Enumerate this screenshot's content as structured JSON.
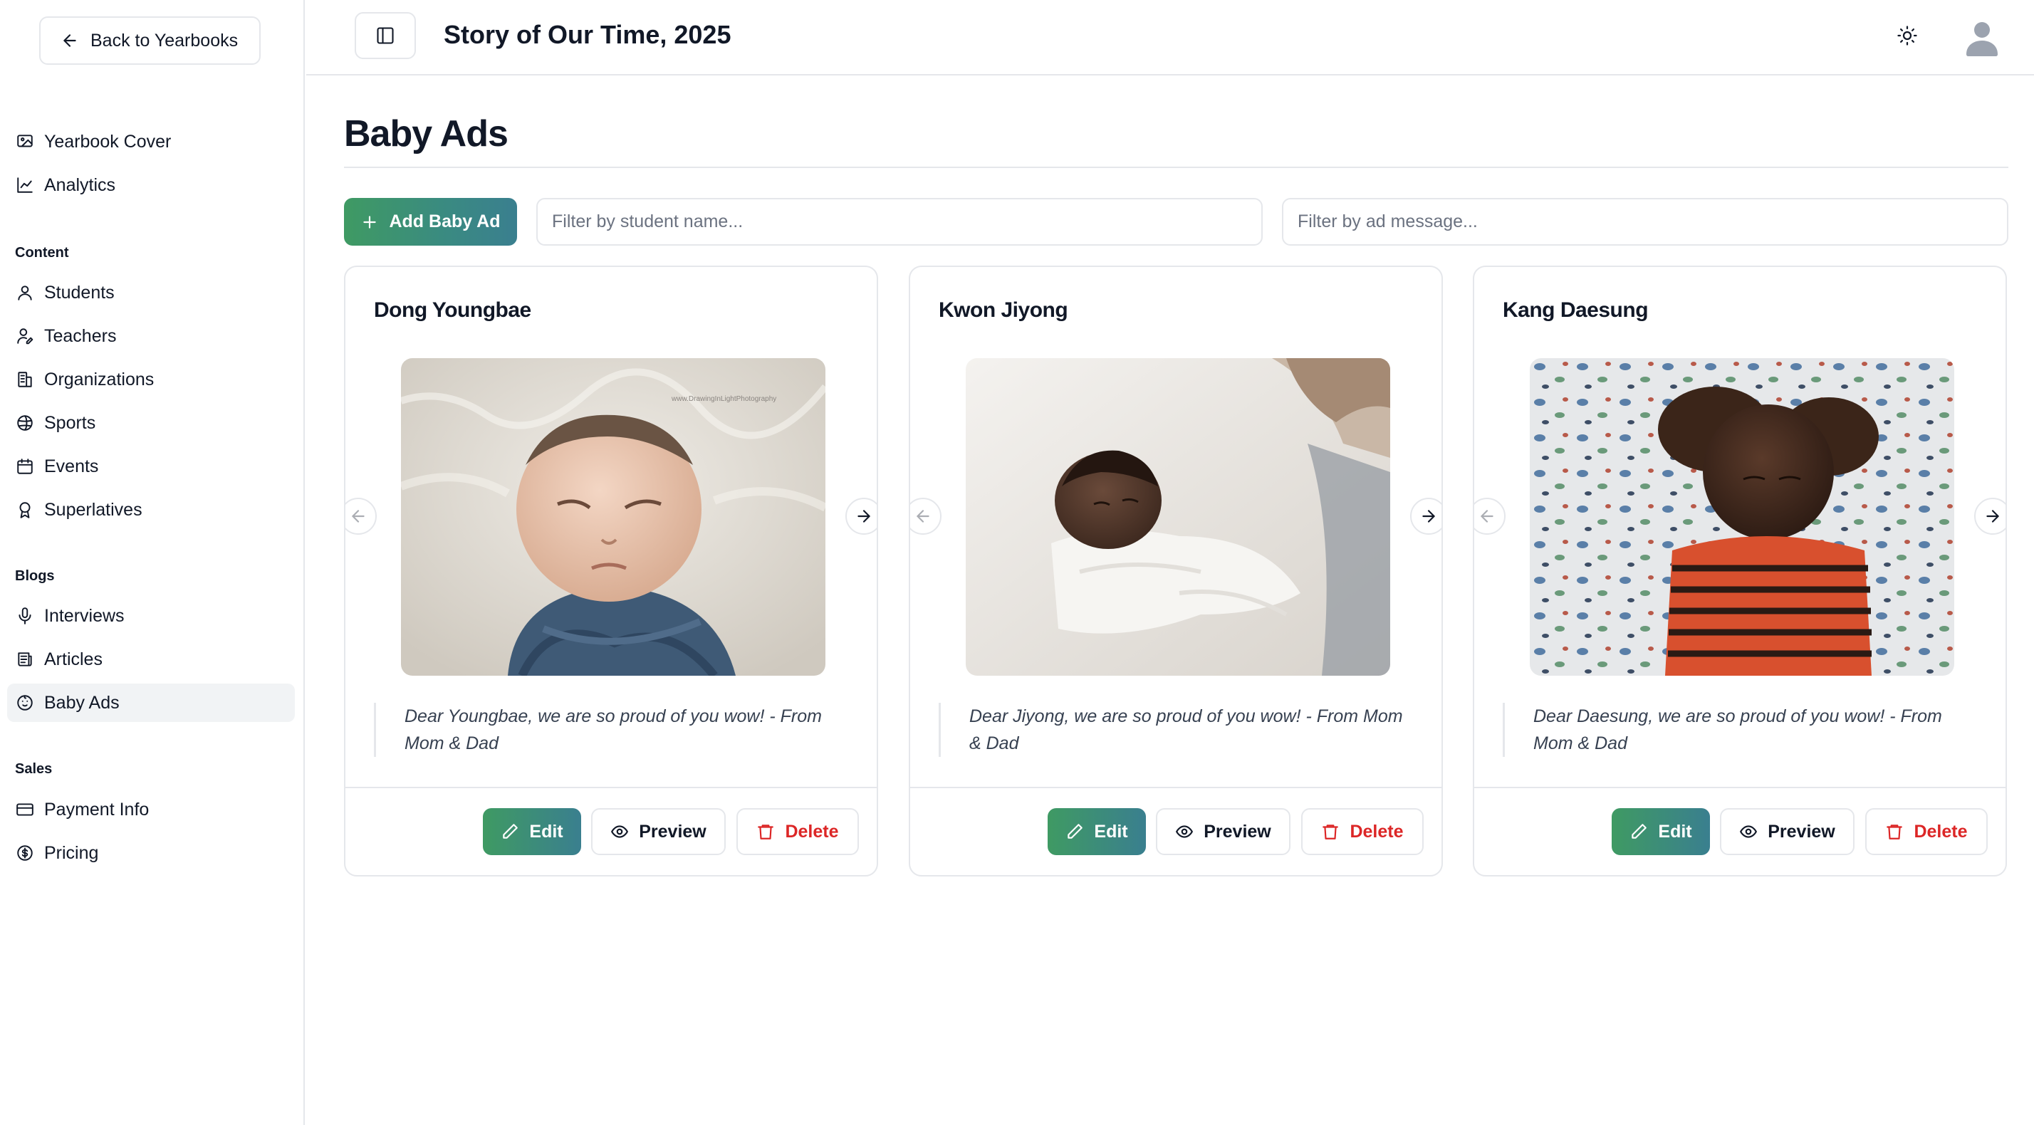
{
  "sidebar": {
    "back_label": "Back to Yearbooks",
    "top_items": [
      {
        "label": "Yearbook Cover",
        "icon": "image-icon"
      },
      {
        "label": "Analytics",
        "icon": "chart-icon"
      }
    ],
    "sections": [
      {
        "heading": "Content",
        "items": [
          "Students",
          "Teachers",
          "Organizations",
          "Sports",
          "Events",
          "Superlatives"
        ]
      },
      {
        "heading": "Blogs",
        "items": [
          "Interviews",
          "Articles",
          "Baby Ads"
        ]
      },
      {
        "heading": "Sales",
        "items": [
          "Payment Info",
          "Pricing"
        ]
      }
    ],
    "active_item": "Baby Ads"
  },
  "header": {
    "title": "Story of Our Time, 2025"
  },
  "main": {
    "title": "Baby Ads",
    "add_label": "Add Baby Ad",
    "filter_student_placeholder": "Filter by student name...",
    "filter_message_placeholder": "Filter by ad message..."
  },
  "cards": [
    {
      "name": "Dong Youngbae",
      "message": "Dear Youngbae, we are so proud of you wow! - From Mom & Dad",
      "watermark": "www.DrawingInLightPhotography"
    },
    {
      "name": "Kwon Jiyong",
      "message": "Dear Jiyong, we are so proud of you wow! - From Mom & Dad"
    },
    {
      "name": "Kang Daesung",
      "message": "Dear Daesung, we are so proud of you wow! - From Mom & Dad"
    }
  ],
  "card_actions": {
    "edit": "Edit",
    "preview": "Preview",
    "delete": "Delete"
  },
  "colors": {
    "accent_green": "#3f9a63",
    "accent_teal": "#3a7f8f",
    "delete_red": "#dc2626",
    "border": "#e5e7eb"
  }
}
